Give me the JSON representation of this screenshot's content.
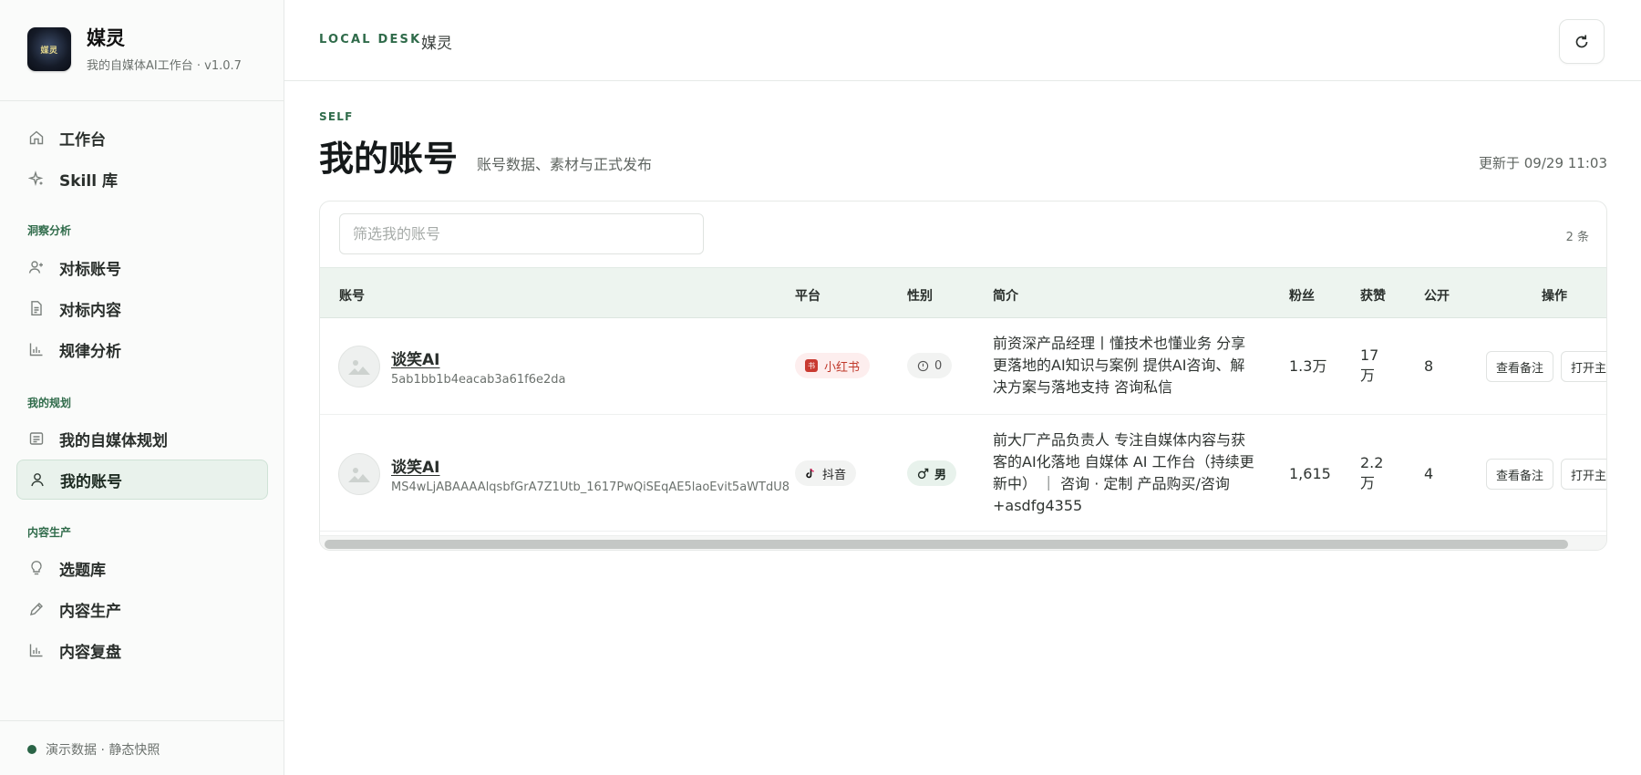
{
  "app": {
    "name": "媒灵",
    "subtitle": "我的自媒体AI工作台 · v1.0.7",
    "logo_text": "媒灵"
  },
  "sidebar": {
    "top_items": [
      {
        "label": "工作台",
        "icon": "home-icon"
      },
      {
        "label": "Skill 库",
        "icon": "sparkle-icon"
      }
    ],
    "sections": [
      {
        "title": "洞察分析",
        "items": [
          {
            "label": "对标账号",
            "icon": "user-plus-icon"
          },
          {
            "label": "对标内容",
            "icon": "document-icon"
          },
          {
            "label": "规律分析",
            "icon": "bar-chart-icon"
          }
        ]
      },
      {
        "title": "我的规划",
        "items": [
          {
            "label": "我的自媒体规划",
            "icon": "plan-icon"
          },
          {
            "label": "我的账号",
            "icon": "user-icon",
            "active": true
          }
        ]
      },
      {
        "title": "内容生产",
        "items": [
          {
            "label": "选题库",
            "icon": "lightbulb-icon"
          },
          {
            "label": "内容生产",
            "icon": "pencil-icon"
          },
          {
            "label": "内容复盘",
            "icon": "bar-chart-icon"
          }
        ]
      }
    ],
    "footer_status": "演示数据 · 静态快照",
    "status_color": "#2a6446"
  },
  "topbar": {
    "label": "LOCAL DESK",
    "title": "媒灵",
    "refresh_icon": "refresh-icon"
  },
  "page": {
    "eyebrow": "SELF",
    "title": "我的账号",
    "subtitle": "账号数据、素材与正式发布",
    "updated": "更新于 09/29 11:03"
  },
  "table": {
    "filter_placeholder": "筛选我的账号",
    "count": "2 条",
    "columns": [
      "账号",
      "平台",
      "性别",
      "简介",
      "粉丝",
      "获赞",
      "公开",
      "操作"
    ],
    "rows": [
      {
        "name": "谈笑AI",
        "id": "5ab1bb1b4eacab3a61f6e2da",
        "platform": "小红书",
        "platform_badge": "书",
        "gender": "0",
        "bio": "前资深产品经理丨懂技术也懂业务 分享更落地的AI知识与案例 提供AI咨询、解决方案与落地支持 咨询私信",
        "fans": "1.3万",
        "likes": "17万",
        "public": "8",
        "actions": [
          "查看备注",
          "打开主页"
        ]
      },
      {
        "name": "谈笑AI",
        "id": "MS4wLjABAAAAlqsbfGrA7Z1Utb_1617PwQiSEqAE5laoEvit5aWTdU8",
        "platform": "抖音",
        "gender": "男",
        "bio": "前大厂产品负责人 专注自媒体内容与获客的AI化落地 自媒体 AI 工作台（持续更新中） ｜ 咨询 · 定制 产品购买/咨询+asdfg4355",
        "fans": "1,615",
        "likes": "2.2万",
        "public": "4",
        "actions": [
          "查看备注",
          "打开主页"
        ]
      }
    ]
  },
  "colors": {
    "accent": "#2f6b4a",
    "header_bg": "#edf4ef",
    "xhs_red": "#c93a31"
  }
}
